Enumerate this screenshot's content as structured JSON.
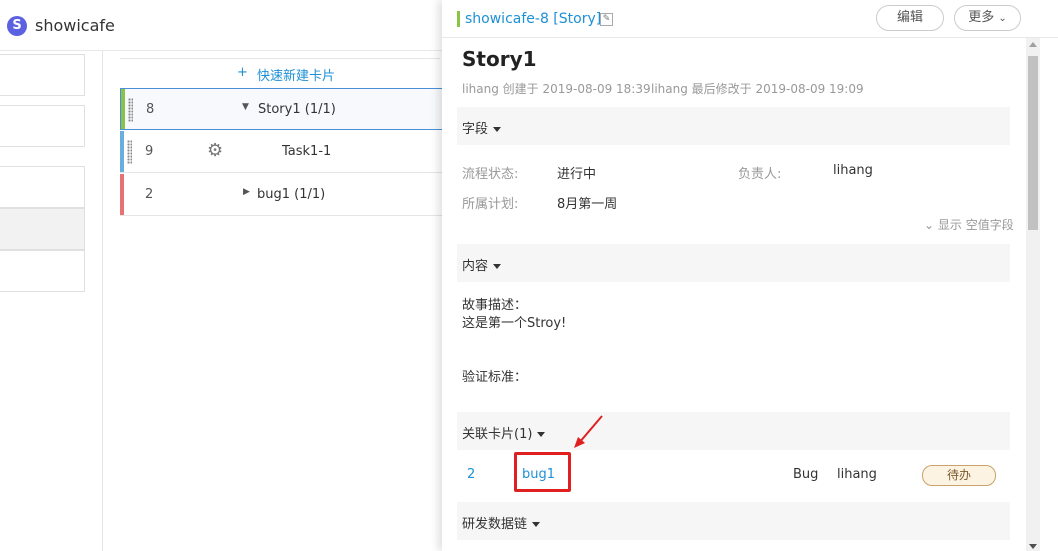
{
  "app": {
    "logo_letter": "S",
    "title": "showicafe"
  },
  "card_list": {
    "quick_add_label": "快速新建卡片",
    "rows": [
      {
        "number": "8",
        "title": "Story1",
        "count": "(1/1)"
      },
      {
        "number": "9",
        "title": "Task1-1"
      },
      {
        "number": "2",
        "title": "bug1",
        "count": "(1/1)"
      }
    ]
  },
  "detail": {
    "breadcrumb": "showicafe-8 [Story]",
    "edit_button": "编辑",
    "more_button": "更多",
    "title": "Story1",
    "created_meta": "lihang 创建于 2019-08-09 18:39",
    "modified_meta": "lihang 最后修改于 2019-08-09 19:09",
    "fields_section": "字段",
    "fields": {
      "status_label": "流程状态:",
      "status_value": "进行中",
      "owner_label": "负责人:",
      "owner_value": "lihang",
      "plan_label": "所属计划:",
      "plan_value": "8月第一周"
    },
    "show_empty_fields": "显示 空值字段",
    "content_section": "内容",
    "content": {
      "story_desc_label": "故事描述：",
      "story_desc_text": "这是第一个Stroy!",
      "acceptance_label": "验证标准："
    },
    "linked_section": "关联卡片(1)",
    "linked_cards": [
      {
        "number": "2",
        "title": "bug1",
        "type": "Bug",
        "owner": "lihang",
        "status": "待办"
      }
    ],
    "devchain_section": "研发数据链"
  },
  "colors": {
    "accent_blue": "#1e90d6",
    "story_stripe": "#8bc34a",
    "task_stripe": "#6aaee0",
    "bug_stripe": "#e57373",
    "highlight_red": "#e02020"
  }
}
